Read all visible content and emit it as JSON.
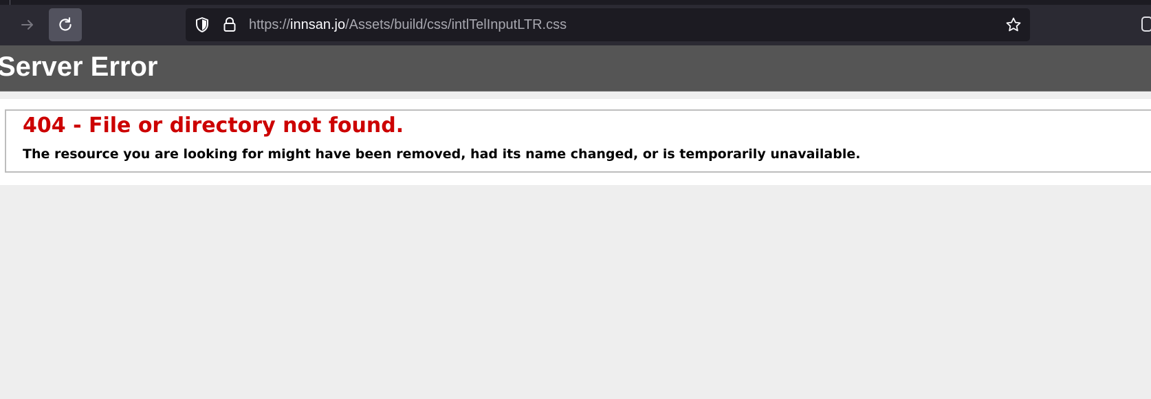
{
  "browser": {
    "url_scheme": "https://",
    "url_host": "innsan.jo",
    "url_path": "/Assets/build/css/intlTelInputLTR.css",
    "colors": {
      "chrome": "#2b2a33",
      "urlbar": "#1c1b22",
      "reload_button": "#52525e"
    },
    "icons": [
      "forward-arrow-icon",
      "reload-icon",
      "shield-icon",
      "lock-icon",
      "bookmark-star-icon",
      "pocket-icon"
    ]
  },
  "page": {
    "header_title": "Server Error",
    "error_title": "404 - File or directory not found.",
    "error_message": "The resource you are looking for might have been removed, had its name changed, or is temporarily unavailable.",
    "colors": {
      "header_bg": "#555555",
      "error_title": "#cc0000",
      "page_bg": "#eeeeee"
    }
  }
}
